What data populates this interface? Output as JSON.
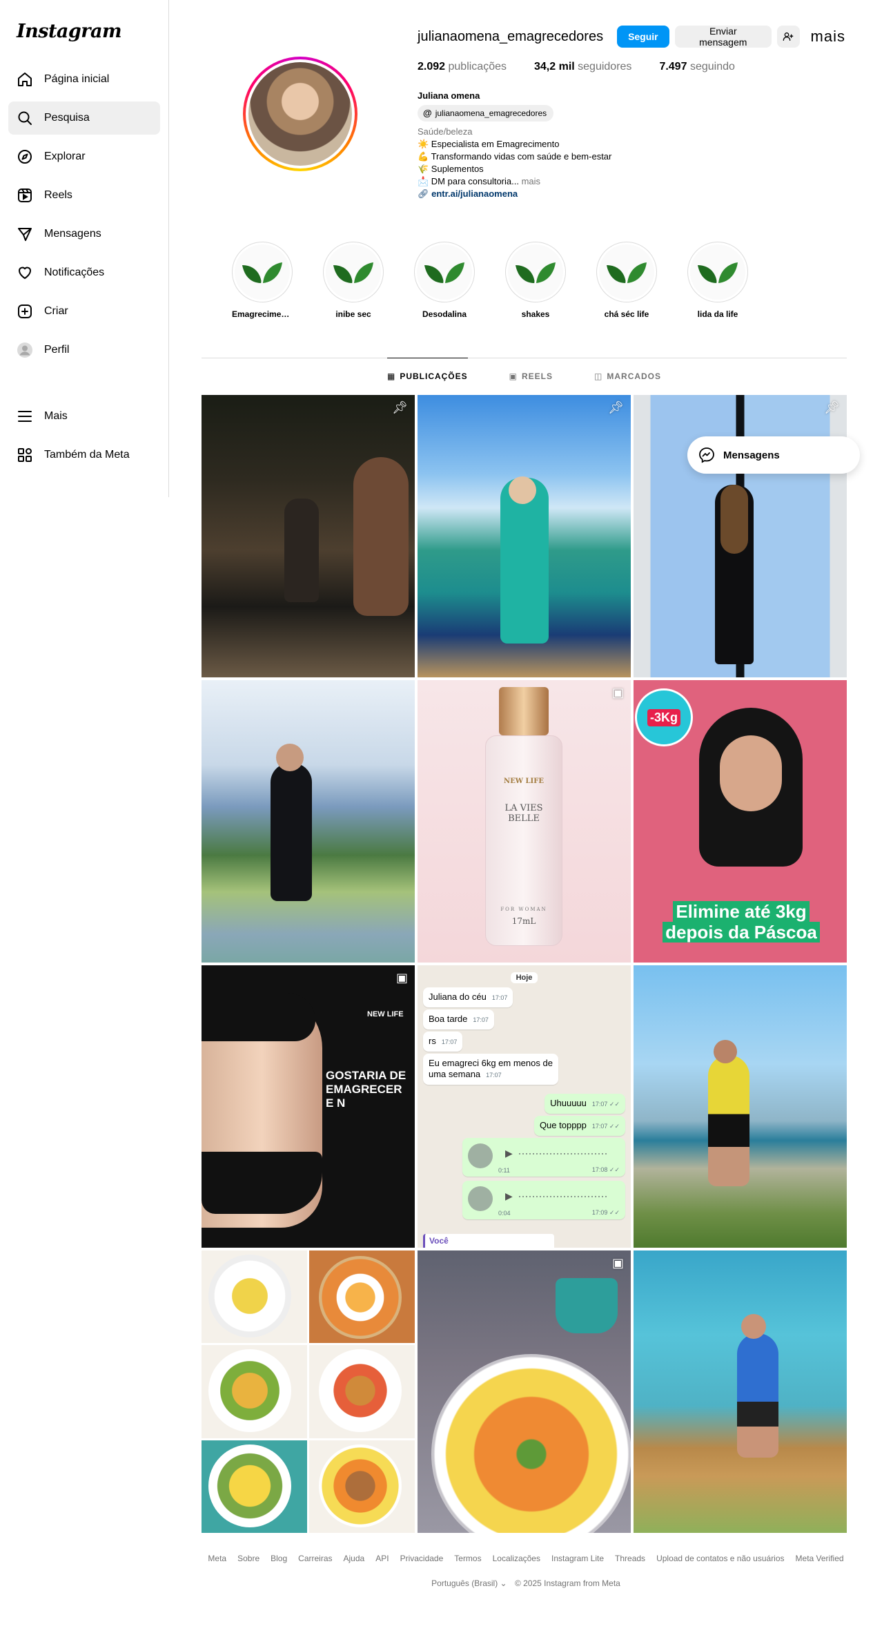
{
  "sidebar": {
    "logo": "Instagram",
    "items": [
      {
        "label": "Página inicial",
        "icon": "home-icon"
      },
      {
        "label": "Pesquisa",
        "icon": "search-icon"
      },
      {
        "label": "Explorar",
        "icon": "compass-icon"
      },
      {
        "label": "Reels",
        "icon": "reels-icon"
      },
      {
        "label": "Mensagens",
        "icon": "send-icon"
      },
      {
        "label": "Notificações",
        "icon": "heart-icon"
      },
      {
        "label": "Criar",
        "icon": "plus-square-icon"
      },
      {
        "label": "Perfil",
        "icon": "avatar-icon"
      }
    ],
    "more": "Mais",
    "meta": "Também da Meta"
  },
  "profile": {
    "username": "julianaomena_emagrecedores",
    "follow_label": "Seguir",
    "message_label": "Enviar mensagem",
    "more_label": "mais",
    "stats": {
      "posts_count": "2.092",
      "posts_label": "publicações",
      "followers_count": "34,2 mil",
      "followers_label": "seguidores",
      "following_count": "7.497",
      "following_label": "seguindo"
    },
    "full_name": "Juliana omena",
    "threads_handle": "julianaomena_emagrecedores",
    "category": "Saúde/beleza",
    "bio_lines": [
      "☀️ Especialista em Emagrecimento",
      "💪 Transformando vidas com saúde e bem-estar",
      "🌾 Suplementos",
      "📩 DM para consultoria..."
    ],
    "link": "entr.ai/julianaomena"
  },
  "highlights": [
    {
      "label": "Emagrecimen..."
    },
    {
      "label": "inibe sec"
    },
    {
      "label": "Desodalina"
    },
    {
      "label": "shakes"
    },
    {
      "label": "chá séc life"
    },
    {
      "label": "lida da life"
    }
  ],
  "tabs": [
    {
      "label": "PUBLICAÇÕES",
      "icon": "grid-icon"
    },
    {
      "label": "REELS",
      "icon": "reels-icon"
    },
    {
      "label": "MARCADOS",
      "icon": "tag-icon"
    }
  ],
  "posts": {
    "p5_brand": "NEW LIFE",
    "p5_name1": "LA VIES",
    "p5_name2": "BELLE",
    "p5_for": "FOR WOMAN",
    "p5_size": "17mL",
    "p6_badge": "-3Kg",
    "p6_title1": "Elimine até 3kg",
    "p6_title2": "depois da Páscoa",
    "p7_brand": "NEW LIFE",
    "p7_text": "GOSTARIA DE EMAGRECER E N",
    "chat": {
      "day": "Hoje",
      "m1": "Juliana do céu",
      "t1": "17:07",
      "m2": "Boa tarde",
      "t2": "17:07",
      "m3": "rs",
      "t3": "17:07",
      "m4": "Eu emagreci 6kg em menos de uma semana",
      "t4": "17:07",
      "m5": "Uhuuuuu",
      "t5": "17:07 ✓✓",
      "m6": "Que topppp",
      "t6": "17:07 ✓✓",
      "a1_dur": "0:11",
      "a1_time": "17:08 ✓✓",
      "a2_dur": "0:04",
      "a2_time": "17:09 ✓✓",
      "you": "Você"
    }
  },
  "floating": {
    "label": "Mensagens"
  },
  "footer": {
    "links": [
      "Meta",
      "Sobre",
      "Blog",
      "Carreiras",
      "Ajuda",
      "API",
      "Privacidade",
      "Termos",
      "Localizações",
      "Instagram Lite",
      "Threads",
      "Upload de contatos e não usuários",
      "Meta Verified"
    ],
    "language": "Português (Brasil) ⌄",
    "copyright": "© 2025 Instagram from Meta"
  },
  "colors": {
    "primary_button": "#0095f6",
    "link": "#00376b",
    "muted": "#737373"
  }
}
